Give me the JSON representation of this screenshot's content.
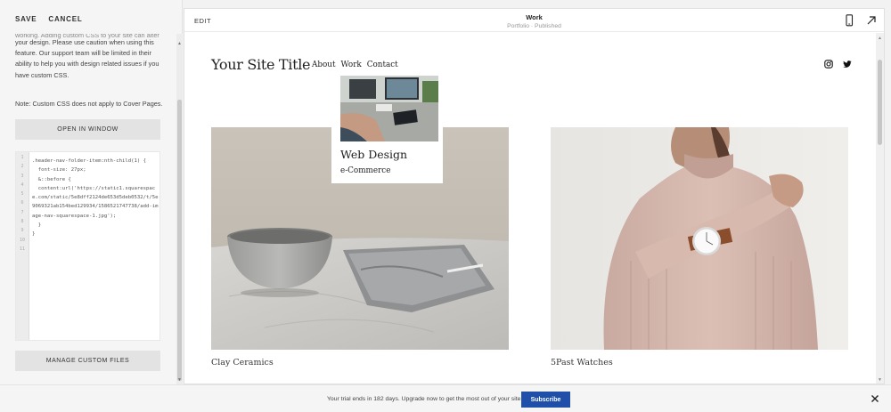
{
  "toolbar": {
    "save_label": "SAVE",
    "cancel_label": "CANCEL"
  },
  "left_panel": {
    "warning_cut": "working. Adding custom CSS to your site can alter",
    "warning_text": "your design. Please use caution when using this feature. Our support team will be limited in their ability to help you with design related issues if you have custom CSS.",
    "note": "Note: Custom CSS does not apply to Cover Pages.",
    "open_window_label": "OPEN IN WINDOW",
    "manage_files_label": "MANAGE CUSTOM FILES",
    "code_lines": [
      ".header-nav-folder-item:nth-child(1) {",
      "  font-size: 27px;",
      "  &::before {",
      "  content:url('https://static1.squarespace.com/static/5e8dff2124de653d5deb0532/t/5e9069321ab154bed129934/1586521747738/add-image-nav-squarespace-1.jpg');",
      "  }",
      "}"
    ],
    "line_numbers": [
      "1",
      "2",
      "3",
      "4",
      "5",
      "6",
      "7",
      "8",
      "9",
      "10",
      "11"
    ]
  },
  "preview": {
    "edit_label": "EDIT",
    "page_title": "Work",
    "page_status": "Portfolio · Published",
    "site_title": "Your Site Title",
    "nav": [
      "About",
      "Work",
      "Contact"
    ],
    "dropdown": {
      "item1": "Web Design",
      "item2": "e-Commerce"
    },
    "products": [
      {
        "label": "Clay Ceramics"
      },
      {
        "label": "5Past Watches"
      }
    ]
  },
  "trial_bar": {
    "text": "Your trial ends in 182 days. Upgrade now to get the most out of your site.",
    "subscribe_label": "Subscribe"
  },
  "colors": {
    "accent": "#1f4fa8",
    "background": "#f2f2f2",
    "panel": "#f5f5f5"
  }
}
